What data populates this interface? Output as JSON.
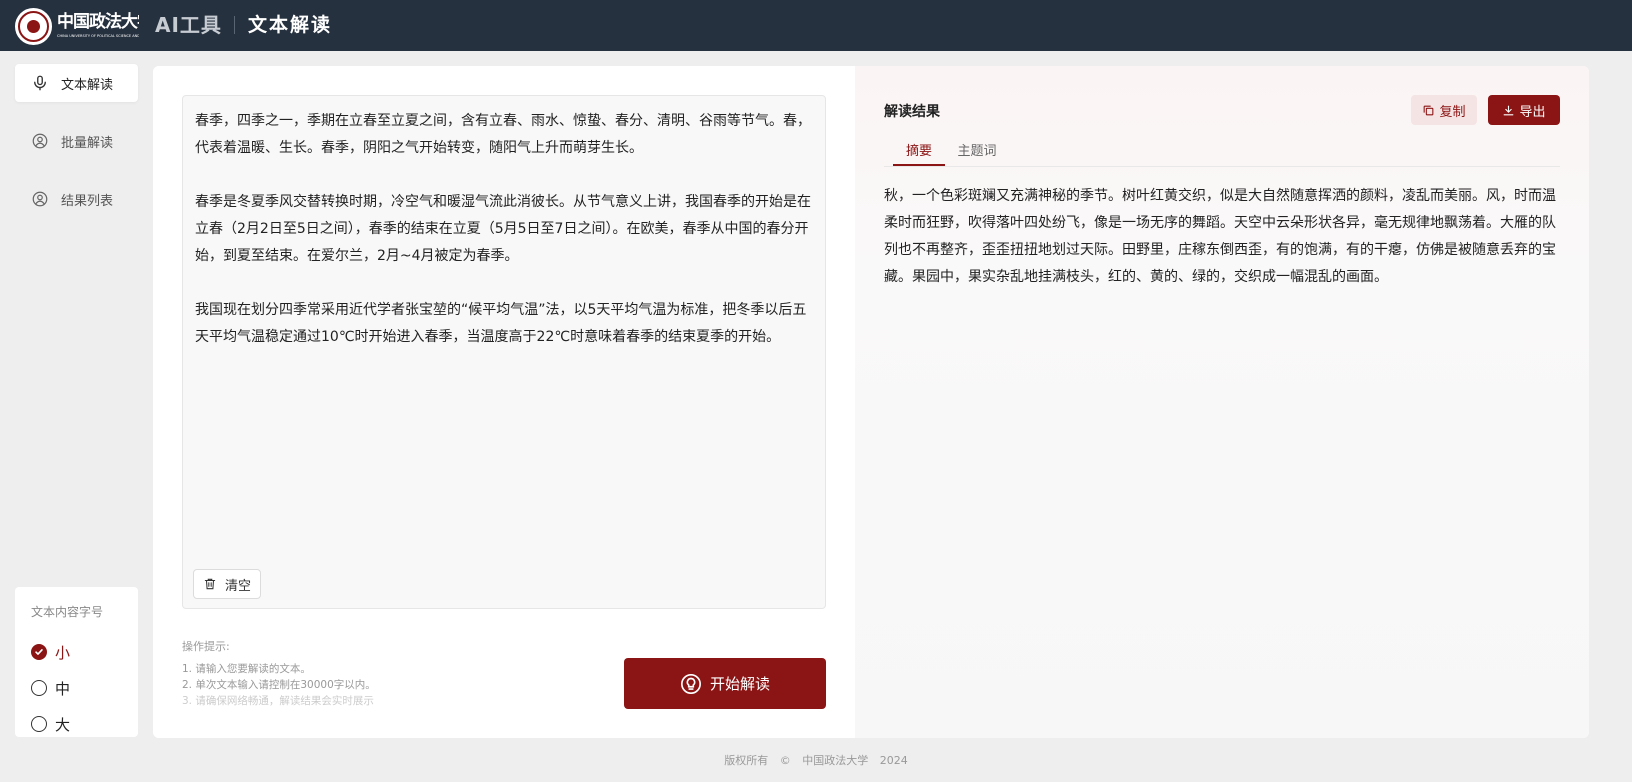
{
  "header": {
    "logo_text": "中国政法大学",
    "logo_subtext": "CHINA UNIVERSITY OF POLITICAL SCIENCE AND LAW",
    "app_name": "AI工具",
    "page_name": "文本解读"
  },
  "sidebar": {
    "items": [
      {
        "label": "文本解读",
        "icon": "microphone-icon",
        "active": true
      },
      {
        "label": "批量解读",
        "icon": "user-circle-icon",
        "active": false
      },
      {
        "label": "结果列表",
        "icon": "user-circle-icon",
        "active": false
      }
    ]
  },
  "font_size_panel": {
    "title": "文本内容字号",
    "options": [
      {
        "label": "小",
        "selected": true
      },
      {
        "label": "中",
        "selected": false
      },
      {
        "label": "大",
        "selected": false
      }
    ]
  },
  "editor": {
    "paragraphs": [
      "春季，四季之一，季期在立春至立夏之间，含有立春、雨水、惊蛰、春分、清明、谷雨等节气。春，代表着温暖、生长。春季，阴阳之气开始转变，随阳气上升而萌芽生长。",
      "春季是冬夏季风交替转换时期，冷空气和暖湿气流此消彼长。从节气意义上讲，我国春季的开始是在立春（2月2日至5日之间），春季的结束在立夏（5月5日至7日之间）。在欧美，春季从中国的春分开始，到夏至结束。在爱尔兰，2月~4月被定为春季。",
      "我国现在划分四季常采用近代学者张宝堃的“候平均气温”法，以5天平均气温为标准，把冬季以后五天平均气温稳定通过10℃时开始进入春季，当温度高于22℃时意味着春季的结束夏季的开始。"
    ],
    "clear_label": "清空"
  },
  "tips": {
    "title": "操作提示:",
    "items": [
      "1. 请输入您要解读的文本。",
      "2. 单次文本输入请控制在30000字以内。",
      "3. 请确保网络畅通，解读结果会实时展示"
    ]
  },
  "start_button": {
    "label": "开始解读"
  },
  "result": {
    "title": "解读结果",
    "copy_label": "复制",
    "export_label": "导出",
    "tabs": [
      {
        "label": "摘要",
        "active": true
      },
      {
        "label": "主题词",
        "active": false
      }
    ],
    "text": "秋，一个色彩斑斓又充满神秘的季节。树叶红黄交织，似是大自然随意挥洒的颜料，凌乱而美丽。风，时而温柔时而狂野，吹得落叶四处纷飞，像是一场无序的舞蹈。天空中云朵形状各异，毫无规律地飘荡着。大雁的队列也不再整齐，歪歪扭扭地划过天际。田野里，庄稼东倒西歪，有的饱满，有的干瘪，仿佛是被随意丢弃的宝藏。果园中，果实杂乱地挂满枝头，红的、黄的、绿的，交织成一幅混乱的画面。"
  },
  "footer": {
    "copyright": "版权所有",
    "symbol": "©",
    "org": "中国政法大学",
    "year": "2024"
  },
  "colors": {
    "brand": "#8b1414",
    "header_bg": "#26313f"
  }
}
